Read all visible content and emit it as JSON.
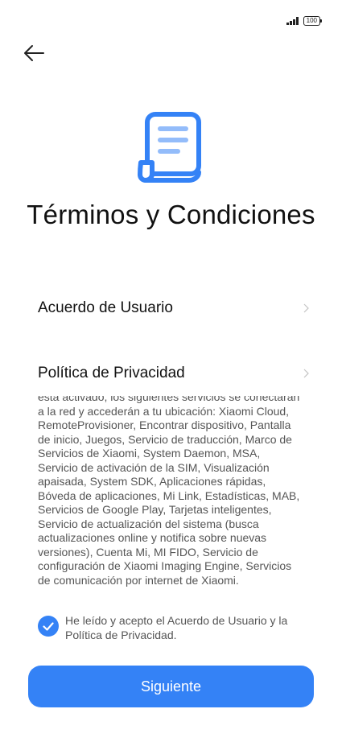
{
  "status_bar": {
    "signal_icon": "signal-bars-icon",
    "battery_level": "100"
  },
  "header": {
    "back_icon": "arrow-left-icon",
    "doc_icon": "document-scroll-icon",
    "title": "Términos y Condiciones"
  },
  "links": {
    "user_agreement": "Acuerdo de Usuario",
    "privacy_policy": "Política de Privacidad"
  },
  "body_text": "esta activado, los siguientes servicios se conectarán a la red y accederán a tu ubicación: Xiaomi Cloud, RemoteProvisioner, Encontrar dispositivo, Pantalla de inicio, Juegos, Servicio de traducción, Marco de Servicios de Xiaomi, System Daemon, MSA, Servicio de activación de la SIM, Visualización apaisada, System SDK, Aplicaciones rápidas, Bóveda de aplicaciones, Mi Link, Estadísticas, MAB, Servicios de Google Play, Tarjetas inteligentes, Servicio de actualización del sistema (busca actualizaciones online y notifica sobre nuevas versiones), Cuenta Mi, MI FIDO, Servicio de configuración de Xiaomi Imaging Engine, Servicios de comunicación por internet de Xiaomi.",
  "consent": {
    "checked": true,
    "text": "He leído y acepto el Acuerdo de Usuario y la Política de Privacidad."
  },
  "primary_button": "Siguiente",
  "colors": {
    "accent": "#3482f6",
    "text": "#111111",
    "muted": "#555555"
  }
}
